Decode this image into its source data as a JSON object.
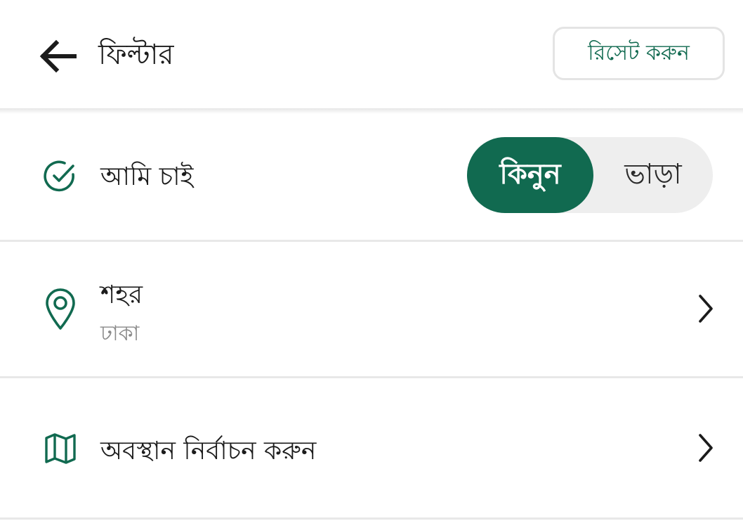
{
  "header": {
    "title": "ফিল্টার",
    "reset_label": "রিসেট করুন",
    "back_icon": "arrow-left-icon"
  },
  "colors": {
    "accent": "#116a50",
    "toggle_bg": "#eeeeee",
    "subtext": "#8a8a8a"
  },
  "intent": {
    "label": "আমি চাই",
    "icon": "check-circle-icon",
    "options": [
      {
        "label": "কিনুন",
        "selected": true
      },
      {
        "label": "ভাড়া",
        "selected": false
      }
    ]
  },
  "city": {
    "label": "শহর",
    "value": "ঢাকা",
    "icon": "location-pin-icon"
  },
  "location": {
    "label": "অবস্থান নির্বাচন করুন",
    "icon": "map-icon"
  }
}
